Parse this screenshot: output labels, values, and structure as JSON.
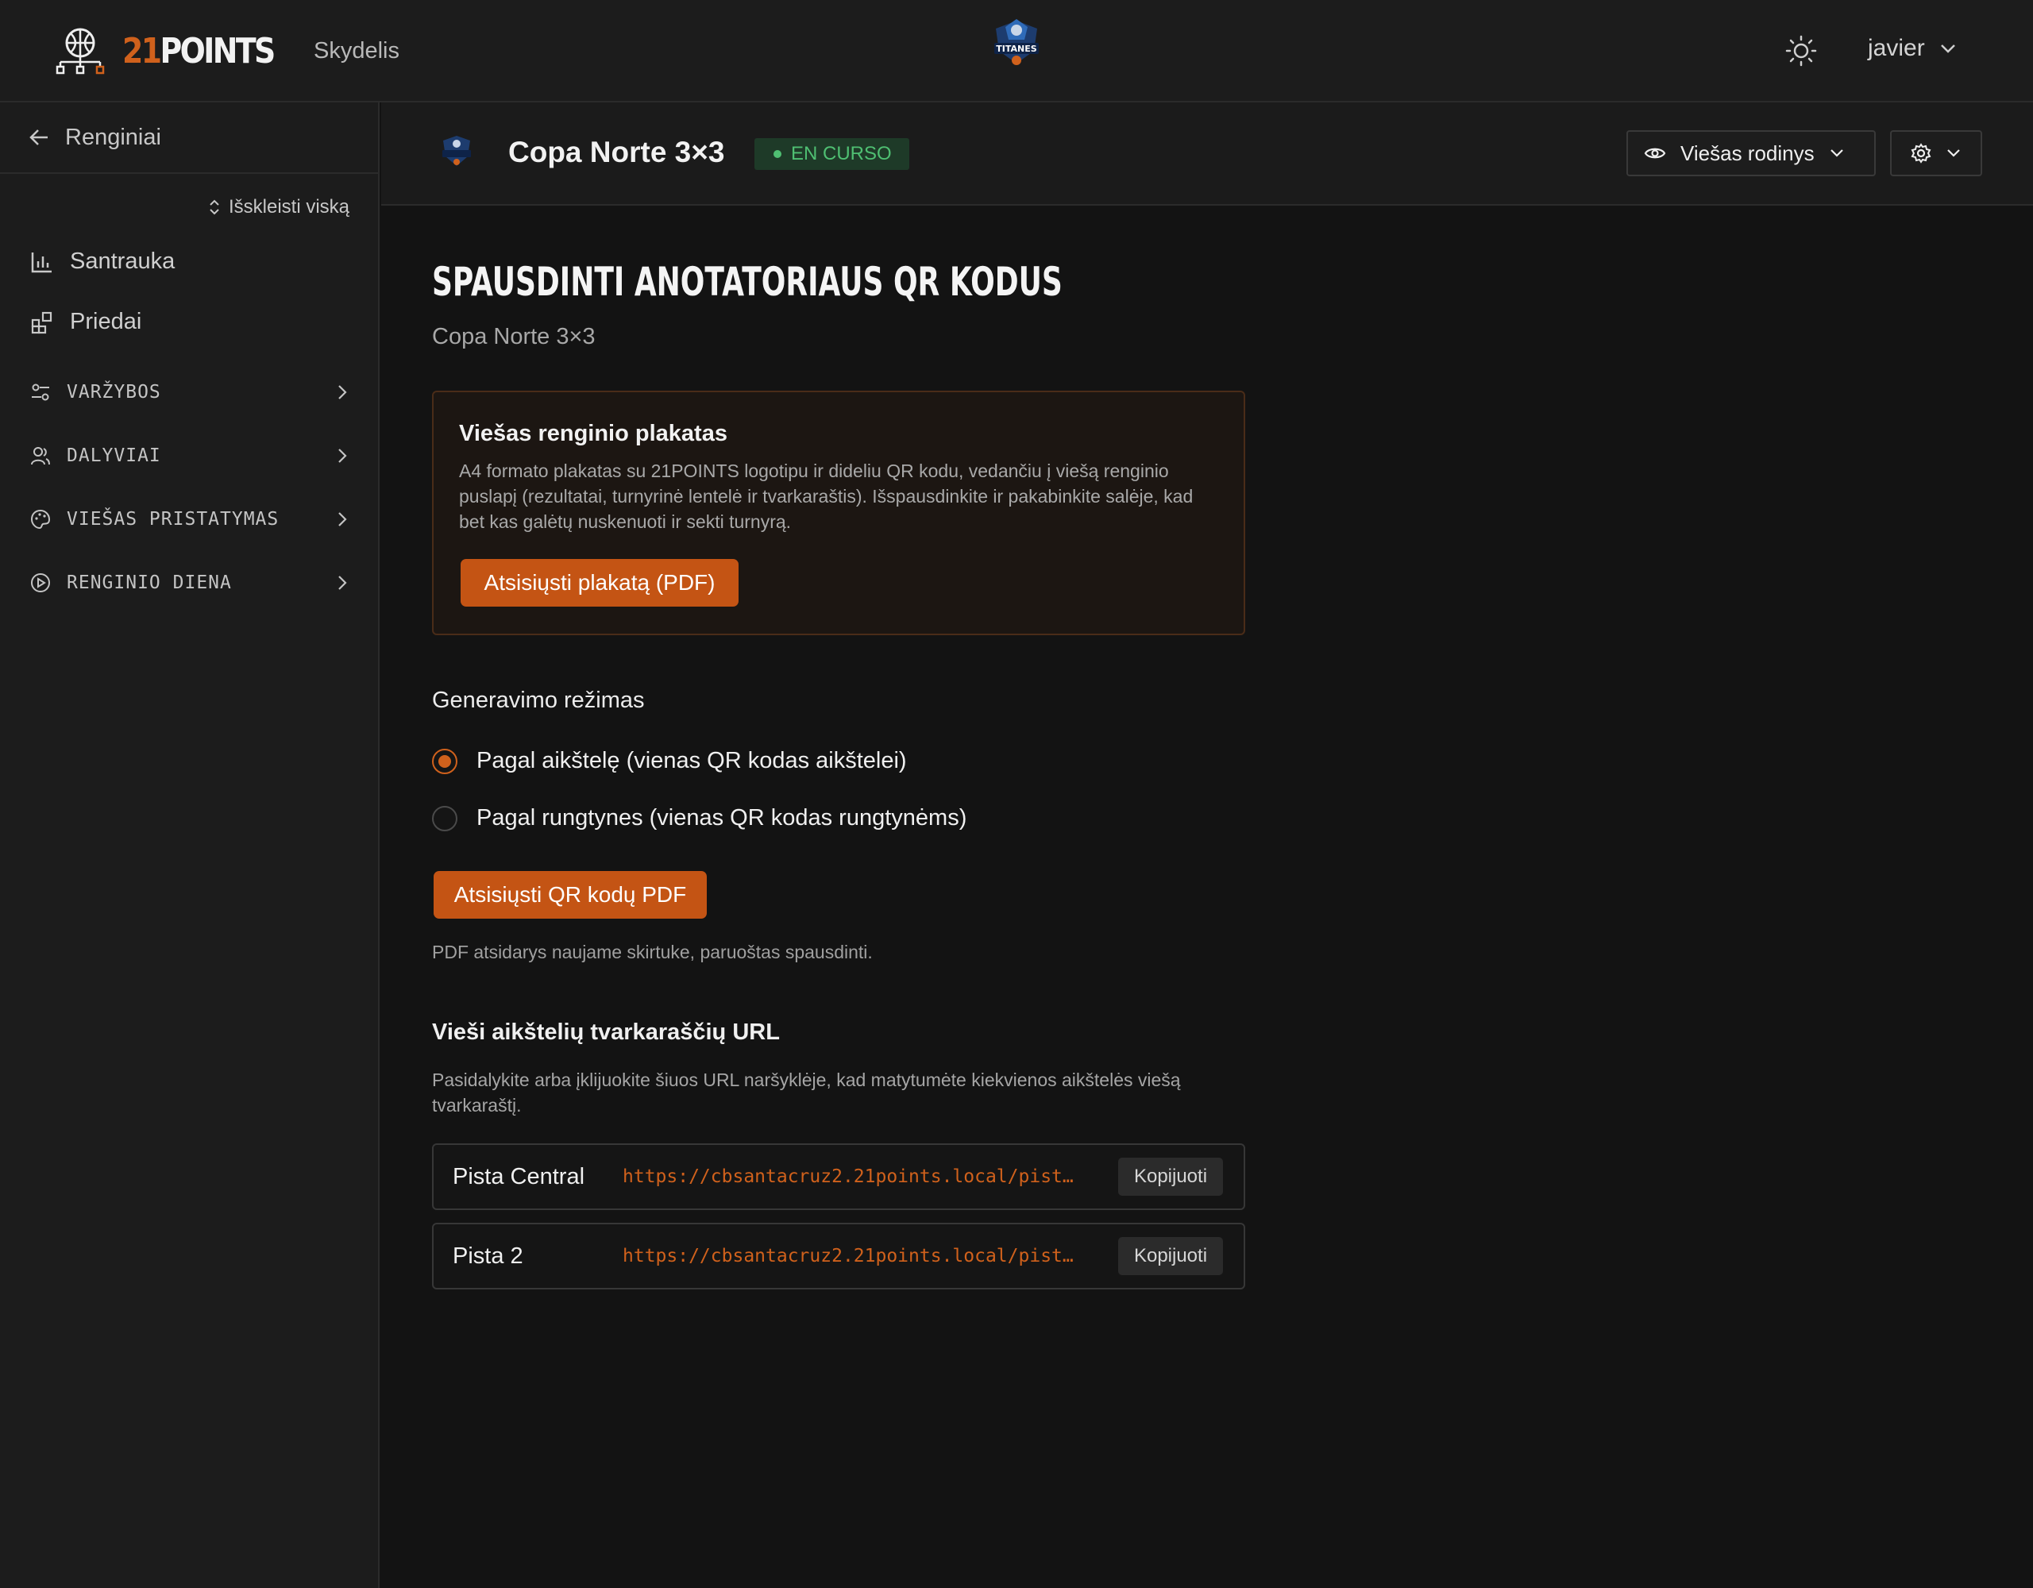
{
  "topbar": {
    "brand_num": "21",
    "brand_text": "POINTS",
    "nav_link": "Skydelis",
    "team_logo_text": "TITANES",
    "user_name": "javier"
  },
  "sidebar": {
    "back_label": "Renginiai",
    "expand_all": "Išskleisti viską",
    "items": [
      {
        "label": "Santrauka",
        "icon": "bar-chart-icon"
      },
      {
        "label": "Priedai",
        "icon": "addons-icon"
      }
    ],
    "sections": [
      {
        "label": "VARŽYBOS",
        "icon": "sliders-icon"
      },
      {
        "label": "DALYVIAI",
        "icon": "users-icon"
      },
      {
        "label": "VIEŠAS PRISTATYMAS",
        "icon": "palette-icon"
      },
      {
        "label": "RENGINIO DIENA",
        "icon": "play-circle-icon"
      }
    ]
  },
  "header": {
    "event_title": "Copa Norte 3×3",
    "status": "EN CURSO",
    "status_color": "#4fbf72",
    "public_view": "Viešas rodinys"
  },
  "main": {
    "title": "SPAUSDINTI ANOTATORIAUS QR KODUS",
    "subtitle": "Copa Norte 3×3",
    "poster": {
      "title": "Viešas renginio plakatas",
      "description": "A4 formato plakatas su 21POINTS logotipu ir dideliu QR kodu, vedančiu į viešą renginio puslapį (rezultatai, turnyrinė lentelė ir tvarkaraštis). Išspausdinkite ir pakabinkite salėje, kad bet kas galėtų nuskenuoti ir sekti turnyrą.",
      "button": "Atsisiųsti plakatą (PDF)"
    },
    "mode": {
      "label": "Generavimo režimas",
      "options": [
        {
          "label": "Pagal aikštelę (vienas QR kodas aikštelei)",
          "checked": true
        },
        {
          "label": "Pagal rungtynes (vienas QR kodas rungtynėms)",
          "checked": false
        }
      ],
      "button": "Atsisiųsti QR kodų PDF",
      "note": "PDF atsidarys naujame skirtuke, paruoštas spausdinti."
    },
    "urls": {
      "title": "Vieši aikštelių tvarkaraščių URL",
      "description": "Pasidalykite arba įklijuokite šiuos URL naršyklėje, kad matytumėte kiekvienos aikštelės viešą tvarkaraštį.",
      "copy_label": "Kopijuoti",
      "rows": [
        {
          "name": "Pista Central",
          "url": "https://cbsantacruz2.21points.local/pist…"
        },
        {
          "name": "Pista 2",
          "url": "https://cbsantacruz2.21points.local/pist…"
        }
      ]
    }
  },
  "colors": {
    "accent": "#d0611c",
    "button": "#c45414",
    "background": "#131313",
    "panel": "#1c1c1c"
  }
}
